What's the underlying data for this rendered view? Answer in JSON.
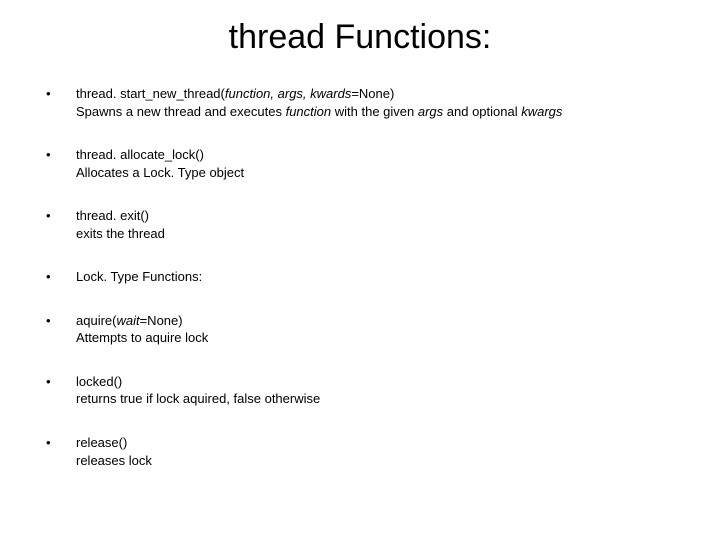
{
  "title": "thread Functions:",
  "items": [
    {
      "sig_pre": "thread. start_new_thread(",
      "sig_args_it": "function, args, kwards",
      "sig_post": "=None)",
      "desc_pre": "Spawns a new thread and executes ",
      "desc_it1": "function",
      "desc_mid": " with the given ",
      "desc_it2": "args",
      "desc_mid2": " and optional ",
      "desc_it3": "kwargs",
      "desc_post": ""
    },
    {
      "sig_pre": "thread. allocate_lock()",
      "sig_args_it": "",
      "sig_post": "",
      "desc_pre": "Allocates a Lock. Type object",
      "desc_it1": "",
      "desc_mid": "",
      "desc_it2": "",
      "desc_mid2": "",
      "desc_it3": "",
      "desc_post": ""
    },
    {
      "sig_pre": "thread. exit()",
      "sig_args_it": "",
      "sig_post": "",
      "desc_pre": "exits the thread",
      "desc_it1": "",
      "desc_mid": "",
      "desc_it2": "",
      "desc_mid2": "",
      "desc_it3": "",
      "desc_post": ""
    },
    {
      "sig_pre": "Lock. Type Functions:",
      "sig_args_it": "",
      "sig_post": "",
      "desc_pre": "",
      "desc_it1": "",
      "desc_mid": "",
      "desc_it2": "",
      "desc_mid2": "",
      "desc_it3": "",
      "desc_post": ""
    },
    {
      "sig_pre": "aquire(",
      "sig_args_it": "wait",
      "sig_post": "=None)",
      "desc_pre": "Attempts to aquire lock",
      "desc_it1": "",
      "desc_mid": "",
      "desc_it2": "",
      "desc_mid2": "",
      "desc_it3": "",
      "desc_post": ""
    },
    {
      "sig_pre": "locked()",
      "sig_args_it": "",
      "sig_post": "",
      "desc_pre": "returns true if lock aquired, false otherwise",
      "desc_it1": "",
      "desc_mid": "",
      "desc_it2": "",
      "desc_mid2": "",
      "desc_it3": "",
      "desc_post": ""
    },
    {
      "sig_pre": "release()",
      "sig_args_it": "",
      "sig_post": "",
      "desc_pre": " releases lock",
      "desc_it1": "",
      "desc_mid": "",
      "desc_it2": "",
      "desc_mid2": "",
      "desc_it3": "",
      "desc_post": ""
    }
  ]
}
